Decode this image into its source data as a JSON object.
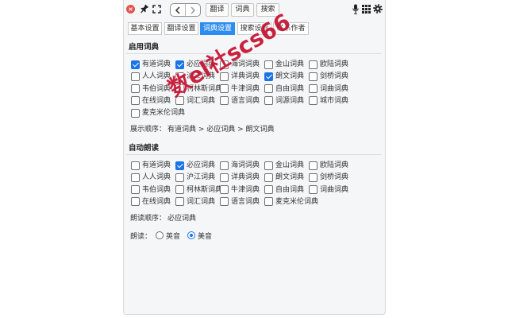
{
  "colors": {
    "accent": "#2d8cf0",
    "checkbox": "#1a73e8",
    "close": "#e5534b",
    "text": "#333333",
    "panel_bg": "#f5f6f8",
    "watermark": "#c41230"
  },
  "toolbar": {
    "icons": {
      "close": "close-icon",
      "pin": "pin-icon",
      "expand": "expand-icon",
      "back": "chevron-left-icon",
      "forward": "chevron-right-icon",
      "microphone": "microphone-icon",
      "apps": "grid-icon",
      "settings": "gear-icon"
    },
    "tabs": [
      {
        "label": "翻译"
      },
      {
        "label": "词典"
      },
      {
        "label": "搜索"
      }
    ]
  },
  "settings_tabs": [
    {
      "label": "基本设置",
      "active": false
    },
    {
      "label": "翻译设置",
      "active": false
    },
    {
      "label": "词典设置",
      "active": true
    },
    {
      "label": "搜索设置",
      "active": false
    },
    {
      "label": "联系作者",
      "active": false
    }
  ],
  "enabled_dictionaries": {
    "title": "启用词典",
    "items": [
      {
        "label": "有道词典",
        "checked": true
      },
      {
        "label": "必应词典",
        "checked": true
      },
      {
        "label": "海词词典",
        "checked": false
      },
      {
        "label": "金山词典",
        "checked": false
      },
      {
        "label": "欧陆词典",
        "checked": false
      },
      {
        "label": "人人词典",
        "checked": false
      },
      {
        "label": "沪江词典",
        "checked": false
      },
      {
        "label": "详典词典",
        "checked": false
      },
      {
        "label": "朗文词典",
        "checked": true
      },
      {
        "label": "剑桥词典",
        "checked": false
      },
      {
        "label": "韦伯词典",
        "checked": false
      },
      {
        "label": "柯林斯词典",
        "checked": false
      },
      {
        "label": "牛津词典",
        "checked": false
      },
      {
        "label": "自由词典",
        "checked": false
      },
      {
        "label": "词曲词典",
        "checked": false
      },
      {
        "label": "在线词典",
        "checked": false
      },
      {
        "label": "词汇词典",
        "checked": false
      },
      {
        "label": "语言词典",
        "checked": false
      },
      {
        "label": "词源词典",
        "checked": false
      },
      {
        "label": "城市词典",
        "checked": false
      },
      {
        "label": "麦克米伦词典",
        "checked": false
      }
    ],
    "order_label": "展示顺序：",
    "order_value": "有道词典 > 必应词典 > 朗文词典"
  },
  "auto_read": {
    "title": "自动朗读",
    "items": [
      {
        "label": "有道词典",
        "checked": false
      },
      {
        "label": "必应词典",
        "checked": true
      },
      {
        "label": "海词词典",
        "checked": false
      },
      {
        "label": "金山词典",
        "checked": false
      },
      {
        "label": "欧陆词典",
        "checked": false
      },
      {
        "label": "人人词典",
        "checked": false
      },
      {
        "label": "沪江词典",
        "checked": false
      },
      {
        "label": "详典词典",
        "checked": false
      },
      {
        "label": "朗文词典",
        "checked": false
      },
      {
        "label": "剑桥词典",
        "checked": false
      },
      {
        "label": "韦伯词典",
        "checked": false
      },
      {
        "label": "柯林斯词典",
        "checked": false
      },
      {
        "label": "牛津词典",
        "checked": false
      },
      {
        "label": "自由词典",
        "checked": false
      },
      {
        "label": "词曲词典",
        "checked": false
      },
      {
        "label": "在线词典",
        "checked": false
      },
      {
        "label": "词汇词典",
        "checked": false
      },
      {
        "label": "语言词典",
        "checked": false
      },
      {
        "label": "麦克米伦词典",
        "checked": false
      }
    ],
    "order_label": "朗读顺序：",
    "order_value": "必应词典",
    "accent_label": "朗读：",
    "accent_options": [
      {
        "label": "英音",
        "selected": false
      },
      {
        "label": "美音",
        "selected": true
      }
    ]
  },
  "watermark": "数el社scs66"
}
